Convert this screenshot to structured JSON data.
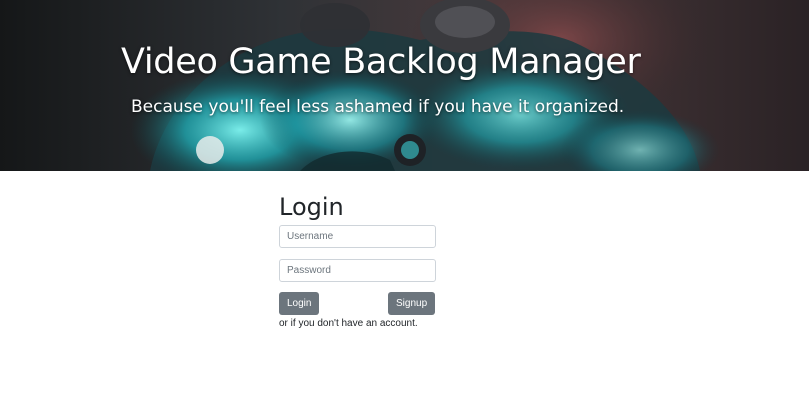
{
  "header": {
    "title": "Video Game Backlog Manager",
    "subtitle": "Because you'll feel less ashamed if you have it organized."
  },
  "login": {
    "heading": "Login",
    "username_placeholder": "Username",
    "username_value": "",
    "password_placeholder": "Password",
    "password_value": "",
    "login_label": "Login",
    "signup_label": "Signup",
    "helper_text": "or if you don't have an account."
  },
  "colors": {
    "button": "#6c757d",
    "text": "#212529",
    "border": "#ced4da",
    "hero_accent": "#3fd0d8"
  }
}
